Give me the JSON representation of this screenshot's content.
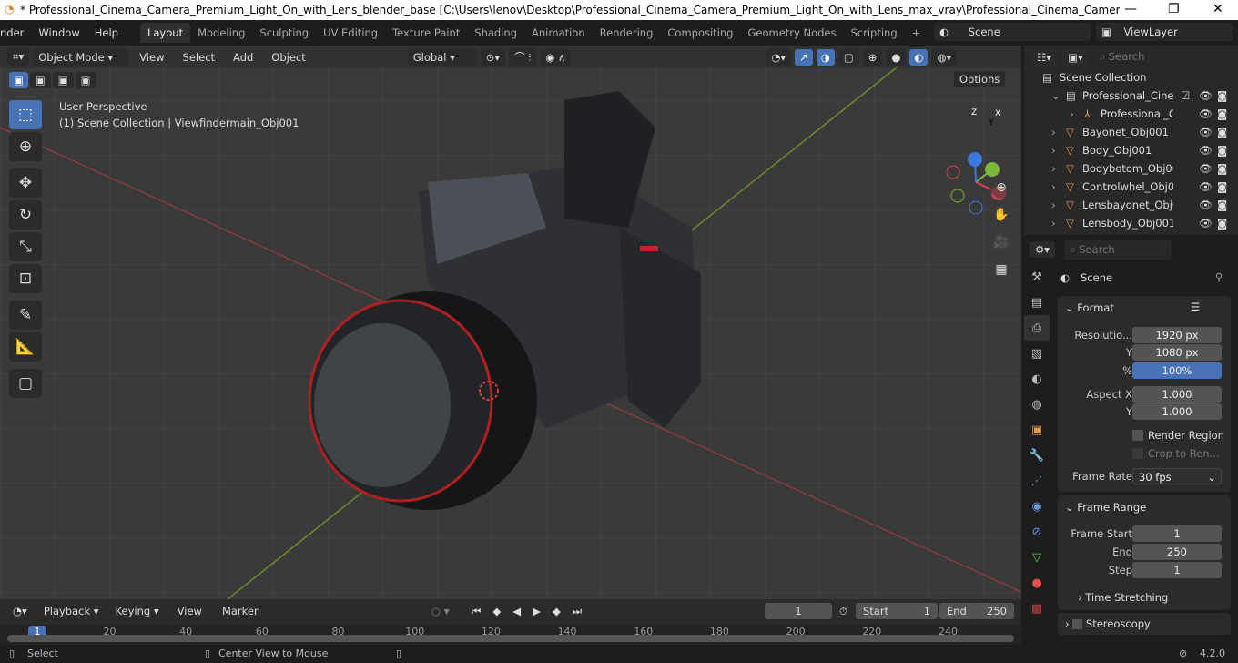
{
  "titlebar": {
    "title": "* Professional_Cinema_Camera_Premium_Light_On_with_Lens_blender_base [C:\\Users\\lenov\\Desktop\\Professional_Cinema_Camera_Premium_Light_On_with_Lens_max_vray\\Professional_Cinema_Camera_Premium_Light_On...",
    "minimize": "—",
    "maximize": "❐",
    "close": "✕"
  },
  "menus": [
    "nder",
    "Window",
    "Help"
  ],
  "workspaces": [
    "Layout",
    "Modeling",
    "Sculpting",
    "UV Editing",
    "Texture Paint",
    "Shading",
    "Animation",
    "Rendering",
    "Compositing",
    "Geometry Nodes",
    "Scripting"
  ],
  "add_workspace": "+",
  "scene": "Scene",
  "view_layer": "ViewLayer",
  "viewport": {
    "mode": "Object Mode",
    "menus": [
      "View",
      "Select",
      "Add",
      "Object"
    ],
    "orientation": "Global",
    "options": "Options",
    "overlay_title": "User Perspective",
    "overlay_sub": "(1) Scene Collection | Viewfindermain_Obj001",
    "gizmo": {
      "x": "X",
      "y": "Y",
      "z": "Z"
    }
  },
  "outliner": {
    "search_placeholder": "Search",
    "root": "Scene Collection",
    "items": [
      {
        "name": "Professional_Cinen",
        "type": "collection"
      },
      {
        "name": "Professional_Ci",
        "type": "empty"
      },
      {
        "name": "Bayonet_Obj001",
        "type": "mesh"
      },
      {
        "name": "Body_Obj001",
        "type": "mesh"
      },
      {
        "name": "Bodybotom_Obj00",
        "type": "mesh"
      },
      {
        "name": "Controlwhel_Obj00",
        "type": "mesh"
      },
      {
        "name": "Lensbayonet_Obj00",
        "type": "mesh"
      },
      {
        "name": "Lensbody_Obj001",
        "type": "mesh"
      }
    ]
  },
  "properties": {
    "search_placeholder": "Search",
    "context": "Scene",
    "format": {
      "title": "Format",
      "resolution_x_label": "Resolutio...",
      "resolution_x": "1920 px",
      "y_label": "Y",
      "resolution_y": "1080 px",
      "pct_label": "%",
      "pct": "100%",
      "aspect_x_label": "Aspect X",
      "aspect_x": "1.000",
      "aspect_y_label": "Y",
      "aspect_y": "1.000",
      "render_region": "Render Region",
      "crop": "Crop to Ren...",
      "frame_rate_label": "Frame Rate",
      "frame_rate": "30 fps"
    },
    "frame_range": {
      "title": "Frame Range",
      "start_label": "Frame Start",
      "start": "1",
      "end_label": "End",
      "end": "250",
      "step_label": "Step",
      "step": "1"
    },
    "time_stretching": "Time Stretching",
    "stereoscopy": "Stereoscopy"
  },
  "timeline": {
    "menus": [
      "Playback",
      "Keying",
      "View",
      "Marker"
    ],
    "current_frame": "1",
    "start_label": "Start",
    "start": "1",
    "end_label": "End",
    "end": "250",
    "ticks": [
      "1",
      "20",
      "40",
      "60",
      "80",
      "100",
      "120",
      "140",
      "160",
      "180",
      "200",
      "220",
      "240"
    ]
  },
  "status": {
    "select": "Select",
    "center": "Center View to Mouse",
    "version": "4.2.0"
  },
  "colors": {
    "accent": "#4772b3",
    "mesh": "#e09a50",
    "x_axis": "#c0394a",
    "y_axis": "#7aa83a"
  }
}
